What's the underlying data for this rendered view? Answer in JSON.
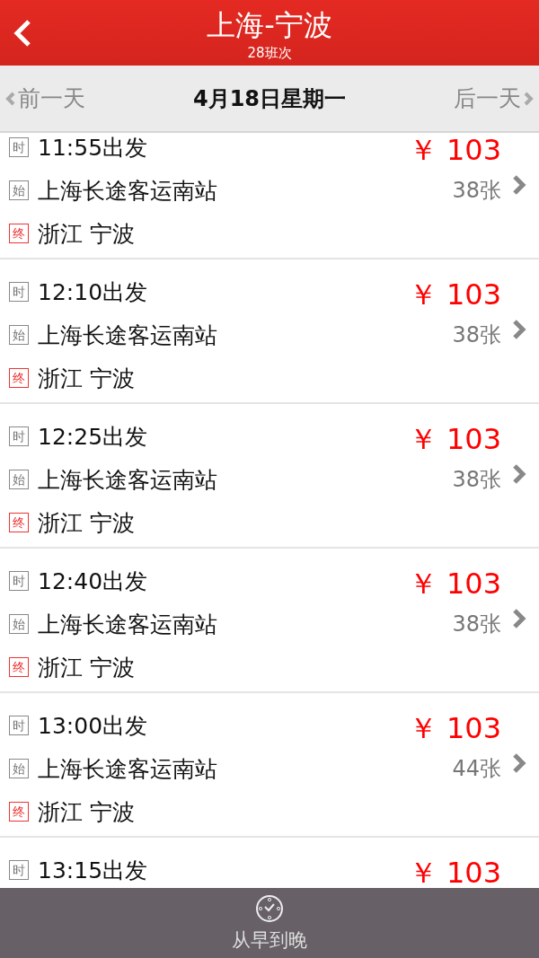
{
  "header": {
    "title": "上海-宁波",
    "subtitle": "28班次"
  },
  "date_bar": {
    "prev": "前一天",
    "date": "4月18日星期一",
    "next": "后一天"
  },
  "trips": [
    {
      "time_tag": "时",
      "time": "11:55出发",
      "price": "￥ 103",
      "origin_tag": "始",
      "origin": "上海长途客运南站",
      "seats": "38张",
      "dest_tag": "终",
      "dest": "浙江 宁波"
    },
    {
      "time_tag": "时",
      "time": "12:10出发",
      "price": "￥ 103",
      "origin_tag": "始",
      "origin": "上海长途客运南站",
      "seats": "38张",
      "dest_tag": "终",
      "dest": "浙江 宁波"
    },
    {
      "time_tag": "时",
      "time": "12:25出发",
      "price": "￥ 103",
      "origin_tag": "始",
      "origin": "上海长途客运南站",
      "seats": "38张",
      "dest_tag": "终",
      "dest": "浙江 宁波"
    },
    {
      "time_tag": "时",
      "time": "12:40出发",
      "price": "￥ 103",
      "origin_tag": "始",
      "origin": "上海长途客运南站",
      "seats": "38张",
      "dest_tag": "终",
      "dest": "浙江 宁波"
    },
    {
      "time_tag": "时",
      "time": "13:00出发",
      "price": "￥ 103",
      "origin_tag": "始",
      "origin": "上海长途客运南站",
      "seats": "44张",
      "dest_tag": "终",
      "dest": "浙江 宁波"
    },
    {
      "time_tag": "时",
      "time": "13:15出发",
      "price": "￥ 103"
    }
  ],
  "bottom_bar": {
    "label": "从早到晚"
  }
}
